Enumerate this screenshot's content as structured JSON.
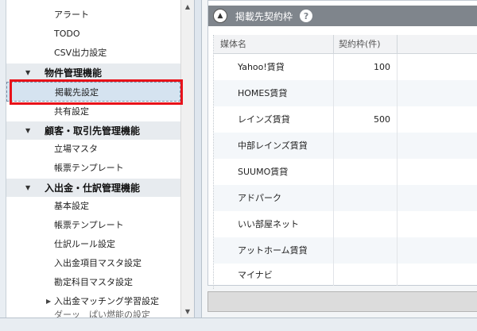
{
  "sidebar": {
    "items": [
      {
        "label": "アラート"
      },
      {
        "label": "TODO"
      },
      {
        "label": "CSV出力設定"
      },
      {
        "label": "物件管理機能"
      },
      {
        "label": "掲載先設定"
      },
      {
        "label": "共有設定"
      },
      {
        "label": "顧客・取引先管理機能"
      },
      {
        "label": "立場マスタ"
      },
      {
        "label": "帳票テンプレート"
      },
      {
        "label": "入出金・仕訳管理機能"
      },
      {
        "label": "基本設定"
      },
      {
        "label": "帳票テンプレート"
      },
      {
        "label": "仕訳ルール設定"
      },
      {
        "label": "入出金項目マスタ設定"
      },
      {
        "label": "勘定科目マスタ設定"
      },
      {
        "label": "入出金マッチング学習設定"
      },
      {
        "label": "ダーッ　ぱい燃能の設定"
      }
    ]
  },
  "panel": {
    "title": "掲載先契約枠",
    "help": "?",
    "collapse": "▲"
  },
  "grid": {
    "columns": [
      "媒体名",
      "契約枠(件)"
    ],
    "rows": [
      {
        "name": "Yahoo!賃貸",
        "quota": "100"
      },
      {
        "name": "HOMES賃貸",
        "quota": ""
      },
      {
        "name": "レインズ賃貸",
        "quota": "500"
      },
      {
        "name": "中部レインズ賃貸",
        "quota": ""
      },
      {
        "name": "SUUMO賃貸",
        "quota": ""
      },
      {
        "name": "アドパーク",
        "quota": ""
      },
      {
        "name": "いい部屋ネット",
        "quota": ""
      },
      {
        "name": "アットホーム賃貸",
        "quota": ""
      },
      {
        "name": "マイナビ",
        "quota": ""
      }
    ]
  },
  "colors": {
    "highlight": "#e8121a",
    "header": "#7f858c",
    "selected": "#d5e3f0"
  }
}
